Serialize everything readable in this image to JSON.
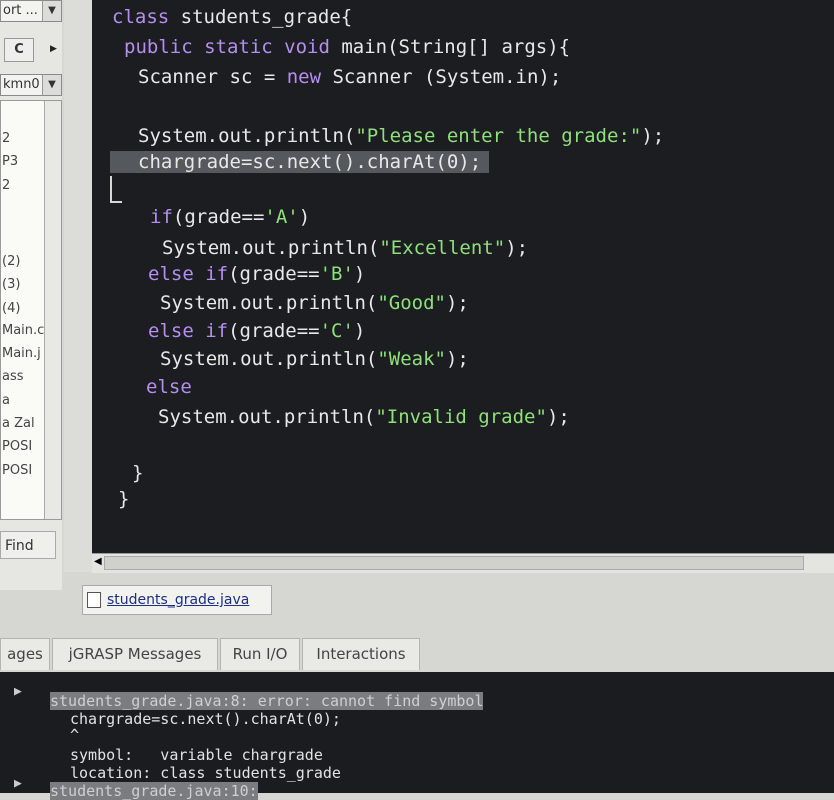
{
  "left_panel": {
    "filter_combo": "ort ...",
    "refresh_icon_letter": "C",
    "path_combo": "kmn0",
    "tree_items": [
      "2",
      "P3",
      "2",
      "(2)",
      "(3)",
      "(4)",
      "Main.c",
      "Main.j",
      "ass",
      "a",
      "a Zal",
      "POSI",
      "POSI"
    ],
    "find_button": "Find"
  },
  "editor": {
    "lines": [
      {
        "kw": "class",
        "rest": " students_grade{"
      },
      {
        "kw": "public static void",
        "rest": " main(String[] args){"
      },
      {
        "pre": "Scanner sc = ",
        "kw": "new",
        "rest": " Scanner (System.in);"
      },
      {
        "pre": "System.out.println(",
        "str": "\"Please enter the grade:\"",
        "rest": ");"
      },
      {
        "pre": "chargrade=sc.next().charAt(0);"
      },
      {
        "kw": "if",
        "pre2": "(grade==",
        "str": "'A'",
        "rest": ")"
      },
      {
        "pre": "System.out.println(",
        "str": "\"Excellent\"",
        "rest": ");"
      },
      {
        "kw": "else if",
        "pre2": "(grade==",
        "str": "'B'",
        "rest": ")"
      },
      {
        "pre": "System.out.println(",
        "str": "\"Good\"",
        "rest": ");"
      },
      {
        "kw": "else if",
        "pre2": "(grade==",
        "str": "'C'",
        "rest": ")"
      },
      {
        "pre": "System.out.println(",
        "str": "\"Weak\"",
        "rest": ");"
      },
      {
        "kw": "else"
      },
      {
        "pre": "System.out.println(",
        "str": "\"Invalid grade\"",
        "rest": ");"
      },
      {
        "pre": "}"
      },
      {
        "pre": "}"
      }
    ]
  },
  "file_tab": {
    "name": "students_grade.java"
  },
  "message_tabs": [
    "ages",
    "jGRASP Messages",
    "Run I/O",
    "Interactions"
  ],
  "messages": {
    "error_line": "students_grade.java:8: error: cannot find symbol",
    "code_line": "chargrade=sc.next().charAt(0);",
    "caret_line": "^",
    "symbol_line": "symbol:   variable chargrade",
    "location_line": "location: class students_grade",
    "next_line": "students_grade.java:10:"
  },
  "colors": {
    "editor_bg": "#1c1d20",
    "keyword": "#b58ef0",
    "string": "#8ee07a",
    "text": "#e8e8e8"
  }
}
